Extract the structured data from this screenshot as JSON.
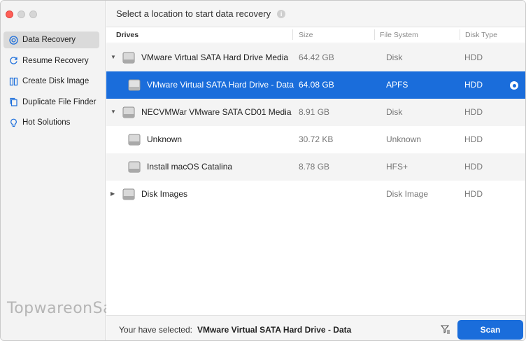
{
  "sidebar": {
    "items": [
      {
        "label": "Data Recovery",
        "icon": "target-icon",
        "active": true
      },
      {
        "label": "Resume Recovery",
        "icon": "refresh-icon",
        "active": false
      },
      {
        "label": "Create Disk Image",
        "icon": "disk-image-icon",
        "active": false
      },
      {
        "label": "Duplicate File Finder",
        "icon": "duplicate-icon",
        "active": false
      },
      {
        "label": "Hot Solutions",
        "icon": "lightbulb-icon",
        "active": false
      }
    ]
  },
  "watermark": "TopwareonSale",
  "header": {
    "title": "Select a location to start data recovery",
    "info": "i"
  },
  "columns": {
    "drives": "Drives",
    "size": "Size",
    "fs": "File System",
    "type": "Disk Type"
  },
  "rows": [
    {
      "name": "VMware Virtual SATA Hard Drive Media",
      "size": "64.42 GB",
      "fs": "Disk",
      "type": "HDD",
      "level": 0,
      "expander": "▼"
    },
    {
      "name": "VMware Virtual SATA Hard Drive - Data",
      "size": "64.08 GB",
      "fs": "APFS",
      "type": "HDD",
      "level": 1,
      "selected": true
    },
    {
      "name": "NECVMWar VMware SATA CD01 Media",
      "size": "8.91 GB",
      "fs": "Disk",
      "type": "HDD",
      "level": 0,
      "expander": "▼"
    },
    {
      "name": "Unknown",
      "size": "30.72 KB",
      "fs": "Unknown",
      "type": "HDD",
      "level": 1
    },
    {
      "name": "Install macOS Catalina",
      "size": "8.78 GB",
      "fs": "HFS+",
      "type": "HDD",
      "level": 1
    },
    {
      "name": "Disk Images",
      "size": "",
      "fs": "Disk Image",
      "type": "HDD",
      "level": 0,
      "expander": "▶"
    }
  ],
  "footer": {
    "label": "Your have selected:",
    "selected": "VMware Virtual SATA Hard Drive - Data",
    "scan": "Scan"
  },
  "colors": {
    "accent": "#1a6ddb",
    "sidebar_bg": "#f3f3f3",
    "alt_row": "#f4f4f4"
  }
}
